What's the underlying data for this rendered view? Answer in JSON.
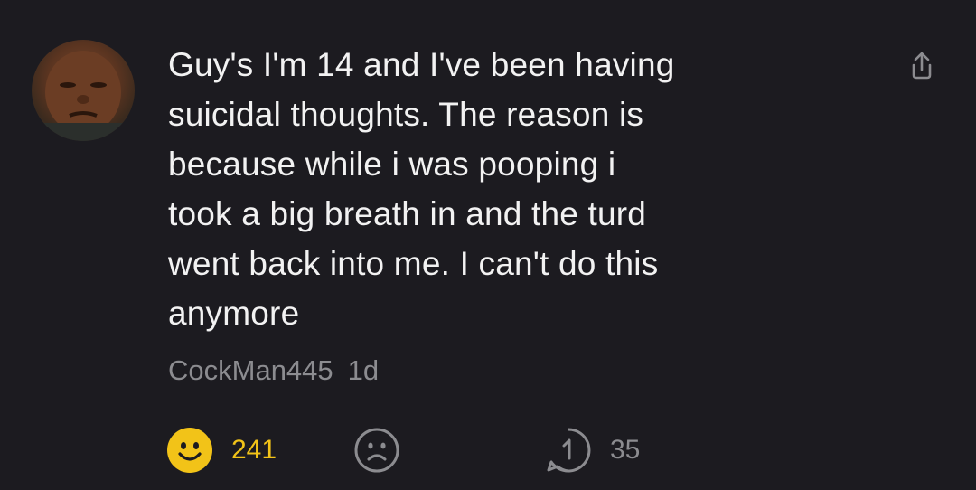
{
  "post": {
    "text": "Guy's I'm 14 and I've been having\nsuicidal thoughts. The reason is\nbecause while i was pooping i\ntook a big breath in and the turd\nwent back into me. I can't do this\nanymore",
    "author": "CockMan445",
    "time": "1d"
  },
  "actions": {
    "like_count": "241",
    "reply_count": "35"
  },
  "icons": {
    "like": "smiley-face-icon",
    "dislike": "sad-face-icon",
    "reply": "reply-arrow-icon",
    "share": "share-icon"
  },
  "colors": {
    "background": "#1c1b20",
    "text": "#f2f2f2",
    "muted": "#8c8c90",
    "like_active": "#f2c318"
  }
}
